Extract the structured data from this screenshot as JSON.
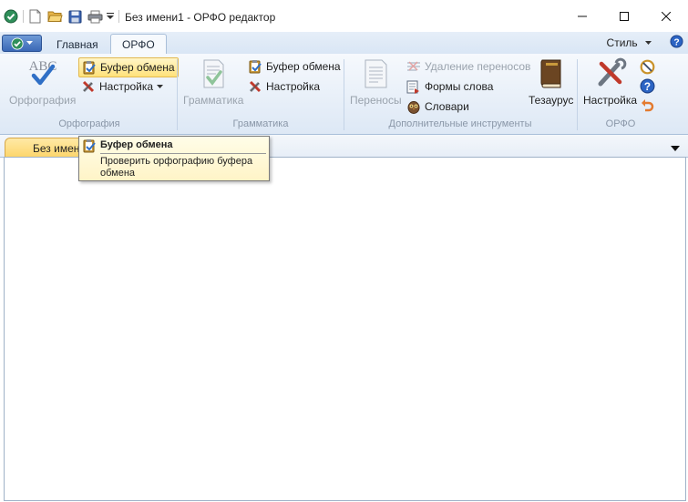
{
  "window": {
    "title": "Без имени1 - ОРФО редактор"
  },
  "tabs": {
    "home_label": "Главная",
    "orfo_label": "ОРФО",
    "style_label": "Стиль"
  },
  "ribbon": {
    "spelling_group": {
      "big_label": "Орфография",
      "clipboard_label": "Буфер обмена",
      "settings_label": "Настройка",
      "group_label": "Орфография"
    },
    "grammar_group": {
      "big_label": "Грамматика",
      "clipboard_label": "Буфер обмена",
      "settings_label": "Настройка",
      "group_label": "Грамматика"
    },
    "tools_group": {
      "hyphen_label": "Переносы",
      "remove_hyphen_label": "Удаление переносов",
      "word_forms_label": "Формы слова",
      "dictionaries_label": "Словари",
      "thesaurus_label": "Тезаурус",
      "group_label": "Дополнительные инструменты"
    },
    "orfo_group": {
      "settings_label": "Настройка",
      "group_label": "ОРФО"
    }
  },
  "document": {
    "tab_label": "Без имени1"
  },
  "tooltip": {
    "title": "Буфер обмена",
    "description": "Проверить орфографию буфера обмена"
  }
}
